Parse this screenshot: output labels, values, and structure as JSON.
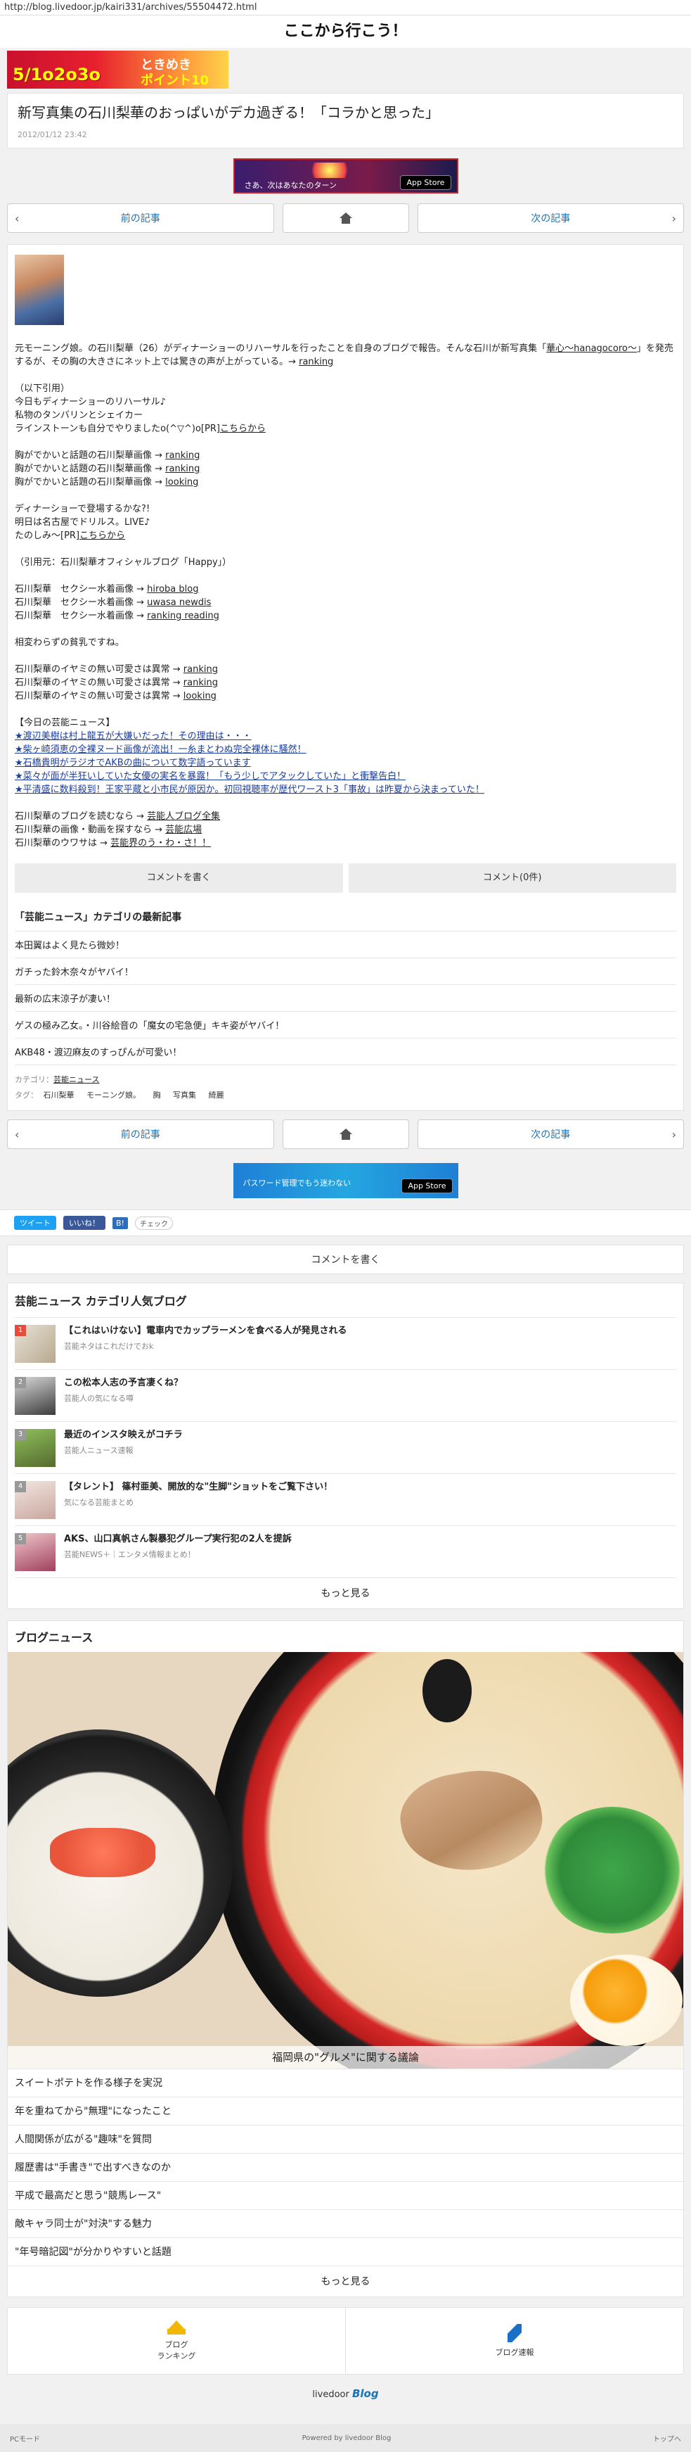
{
  "url": "http://blog.livedoor.jp/kairi331/archives/55504472.html",
  "site_title": "ここから行こう！",
  "top_banner": {
    "line1": "",
    "line2": "5/1o2o3o",
    "line3": "ときめき",
    "line4": "ポイント10"
  },
  "post": {
    "title": "新写真集の石川梨華のおっぱいがデカ過ぎる！「コラかと思った」",
    "date": "2012/01/12 23:42"
  },
  "app_banner_1": {
    "text": "さあ、次はあなたのターン",
    "store": "App Store"
  },
  "nav": {
    "prev": "前の記事",
    "next": "次の記事"
  },
  "article": {
    "p1_a": "元モーニング娘。の石川梨華（26）がディナーショーのリハーサルを行ったことを自身のブログで報告。そんな石川が新写真集「",
    "p1_link": "華心〜hanagocoro〜",
    "p1_b": "」を発売するが、その胸の大きさにネット上では驚きの声が上がっている。→ ",
    "p1_rank": "ranking",
    "quote_head": "（以下引用）",
    "quote_1": "今日もディナーショーのリハーサル♪",
    "quote_2": "私物のタンバリンとシェイカー",
    "quote_3_a": "ラインストーンも自分でやりましたo(^▽^)o[PR]",
    "quote_3_link": "こちらから",
    "list1": [
      {
        "text": "胸がでかいと話題の石川梨華画像 → ",
        "link": "ranking"
      },
      {
        "text": "胸がでかいと話題の石川梨華画像 → ",
        "link": "ranking"
      },
      {
        "text": "胸がでかいと話題の石川梨華画像 → ",
        "link": "looking"
      }
    ],
    "quote_4": "ディナーショーで登場するかな?!",
    "quote_5": "明日は名古屋でドリルス。LIVE♪",
    "quote_6_a": "たのしみ～[PR]",
    "quote_6_link": "こちらから",
    "source": "（引用元：石川梨華オフィシャルブログ「Happy」）",
    "list2": [
      {
        "text": "石川梨華　セクシー水着画像 → ",
        "link": "hiroba blog"
      },
      {
        "text": "石川梨華　セクシー水着画像 → ",
        "link": "uwasa newdis"
      },
      {
        "text": "石川梨華　セクシー水着画像 → ",
        "link": "ranking reading"
      }
    ],
    "comment": "相変わらずの貧乳ですね。",
    "list3": [
      {
        "text": "石川梨華のイヤミの無い可愛さは異常 → ",
        "link": "ranking"
      },
      {
        "text": "石川梨華のイヤミの無い可愛さは異常 → ",
        "link": "ranking"
      },
      {
        "text": "石川梨華のイヤミの無い可愛さは異常 → ",
        "link": "looking"
      }
    ],
    "news_head": "【今日の芸能ニュース】",
    "news": [
      "★渡辺美樹は村上龍五が大嫌いだった！その理由は・・・",
      "★柴ヶ崎須恵の全裸ヌード画像が流出！一糸まとわぬ完全裸体に騒然！",
      "★石橋貴明がラジオでAKBの曲について数字語っています",
      "★菜々が面が半狂いしていた女優の実名を暴露！「もう少しでアタックしていた」と衝撃告白！",
      "★平清盛に数料殺到！王家平蔵と小市民が原因か。初回視聴率が歴代ワースト3「事故」は昨夏から決まっていた！"
    ],
    "tail": [
      {
        "text": "石川梨華のブログを読むなら → ",
        "link": "芸能人ブログ全集"
      },
      {
        "text": "石川梨華の画像・動画を探すなら → ",
        "link": "芸能広場"
      },
      {
        "text": "石川梨華のウワサは → ",
        "link": "芸能界のう・わ・さ！！"
      }
    ]
  },
  "buttons": {
    "write_comment": "コメントを書く",
    "comments": "コメント(0件)"
  },
  "latest": {
    "head": "「芸能ニュース」カテゴリの最新記事",
    "items": [
      "本田翼はよく見たら微妙！",
      "ガチった鈴木奈々がヤバイ！",
      "最新の広末涼子が凄い！",
      "ゲスの極み乙女。・川谷絵音の「魔女の宅急便」キキ姿がヤバイ！",
      "AKB48・渡辺麻友のすっぴんが可愛い！"
    ]
  },
  "meta": {
    "category_label": "カテゴリ：",
    "category": "芸能ニュース",
    "tag_label": "タグ：",
    "tags": [
      "石川梨華",
      "モーニング娘。",
      "胸",
      "写真集",
      "綺麗"
    ]
  },
  "app_banner_2": {
    "text": "パスワード管理でもう迷わない",
    "store": "App Store"
  },
  "share": {
    "tweet": "ツイート",
    "like": "いいね！",
    "hatena": "B!",
    "check": "チェック"
  },
  "comment_bar": "コメントを書く",
  "popular": {
    "title": "芸能ニュース カテゴリ人気ブログ",
    "items": [
      {
        "rank": "1",
        "title": "【これはいけない】電車内でカップラーメンを食べる人が発見される",
        "sub": "芸能ネタはこれだけでおk"
      },
      {
        "rank": "2",
        "title": "この松本人志の予言凄くね？",
        "sub": "芸能人の気になる噂"
      },
      {
        "rank": "3",
        "title": "最近のインスタ映えがコチラ",
        "sub": "芸能人ニュース速報"
      },
      {
        "rank": "4",
        "title": "【タレント】 篠村亜美、開放的な\"生脚\"ショットをご覧下さい！",
        "sub": "気になる芸能まとめ"
      },
      {
        "rank": "5",
        "title": "AKS、山口真帆さん製暴犯グループ実行犯の2人を提訴",
        "sub": "芸能NEWS＋｜エンタメ情報まとめ！"
      }
    ],
    "more": "もっと見る"
  },
  "blog_news": {
    "title": "ブログニュース",
    "caption": "福岡県の\"グルメ\"に関する議論",
    "items": [
      "スイートポテトを作る様子を実況",
      "年を重ねてから\"無理\"になったこと",
      "人間関係が広がる\"趣味\"を質問",
      "履歴書は\"手書き\"で出すべきなのか",
      "平成で最高だと思う\"競馬レース\"",
      "敵キャラ同士が\"対決\"する魅力",
      "\"年号暗記図\"が分かりやすいと話題"
    ],
    "more": "もっと見る"
  },
  "footer": {
    "ranking": "ブログ\nランキング",
    "ranking_l1": "ブログ",
    "ranking_l2": "ランキング",
    "speed": "ブログ速報",
    "logo_l": "livedoor",
    "logo_r": "Blog",
    "pc_mode": "PCモード",
    "powered": "Powered by livedoor Blog",
    "top": "トップへ"
  }
}
